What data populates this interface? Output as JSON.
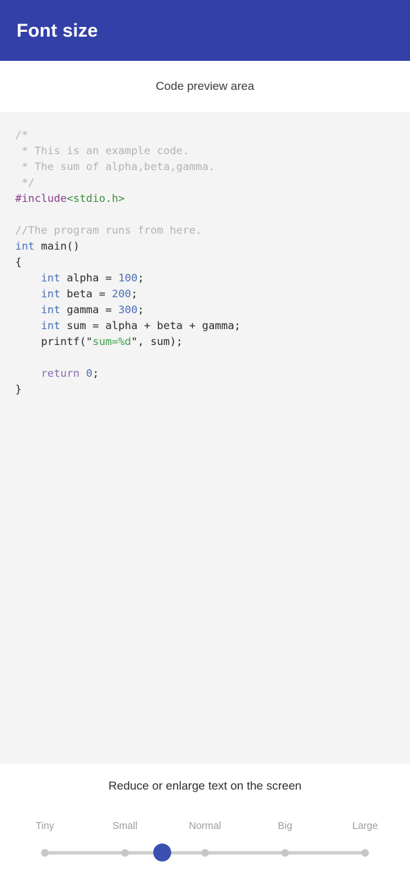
{
  "appbar": {
    "title": "Font size"
  },
  "preview": {
    "caption": "Code preview area",
    "code_lines": [
      {
        "segments": [
          {
            "t": "/*",
            "c": "cmt"
          }
        ]
      },
      {
        "segments": [
          {
            "t": " * This is an example code.",
            "c": "cmt"
          }
        ]
      },
      {
        "segments": [
          {
            "t": " * The sum of alpha,beta,gamma.",
            "c": "cmt"
          }
        ]
      },
      {
        "segments": [
          {
            "t": " */",
            "c": "cmt"
          }
        ]
      },
      {
        "segments": [
          {
            "t": "#include",
            "c": "pre"
          },
          {
            "t": "<stdio.h>",
            "c": "inc"
          }
        ]
      },
      {
        "segments": [
          {
            "t": "",
            "c": "pun"
          }
        ]
      },
      {
        "segments": [
          {
            "t": "//The program runs from here.",
            "c": "cmt"
          }
        ]
      },
      {
        "segments": [
          {
            "t": "int",
            "c": "kw"
          },
          {
            "t": " main()",
            "c": "pun"
          }
        ]
      },
      {
        "segments": [
          {
            "t": "{",
            "c": "pun"
          }
        ]
      },
      {
        "segments": [
          {
            "t": "    ",
            "c": "pun"
          },
          {
            "t": "int",
            "c": "kw"
          },
          {
            "t": " alpha = ",
            "c": "pun"
          },
          {
            "t": "100",
            "c": "num"
          },
          {
            "t": ";",
            "c": "pun"
          }
        ]
      },
      {
        "segments": [
          {
            "t": "    ",
            "c": "pun"
          },
          {
            "t": "int",
            "c": "kw"
          },
          {
            "t": " beta = ",
            "c": "pun"
          },
          {
            "t": "200",
            "c": "num"
          },
          {
            "t": ";",
            "c": "pun"
          }
        ]
      },
      {
        "segments": [
          {
            "t": "    ",
            "c": "pun"
          },
          {
            "t": "int",
            "c": "kw"
          },
          {
            "t": " gamma = ",
            "c": "pun"
          },
          {
            "t": "300",
            "c": "num"
          },
          {
            "t": ";",
            "c": "pun"
          }
        ]
      },
      {
        "segments": [
          {
            "t": "    ",
            "c": "pun"
          },
          {
            "t": "int",
            "c": "kw"
          },
          {
            "t": " sum = alpha + beta + gamma;",
            "c": "pun"
          }
        ]
      },
      {
        "segments": [
          {
            "t": "    printf(\"",
            "c": "pun"
          },
          {
            "t": "sum=%d",
            "c": "str"
          },
          {
            "t": "\", sum);",
            "c": "pun"
          }
        ]
      },
      {
        "segments": [
          {
            "t": "",
            "c": "pun"
          }
        ]
      },
      {
        "segments": [
          {
            "t": "    ",
            "c": "pun"
          },
          {
            "t": "return",
            "c": "kw2"
          },
          {
            "t": " ",
            "c": "pun"
          },
          {
            "t": "0",
            "c": "num"
          },
          {
            "t": ";",
            "c": "pun"
          }
        ]
      },
      {
        "segments": [
          {
            "t": "}",
            "c": "pun"
          }
        ]
      }
    ]
  },
  "slider": {
    "caption": "Reduce or enlarge text on the screen",
    "ticks": [
      {
        "label": "Tiny",
        "pos_pct": 0
      },
      {
        "label": "Small",
        "pos_pct": 25
      },
      {
        "label": "Normal",
        "pos_pct": 50
      },
      {
        "label": "Big",
        "pos_pct": 75
      },
      {
        "label": "Large",
        "pos_pct": 100
      }
    ],
    "thumb_pos_pct": 36.6,
    "selected_value": "Small"
  },
  "colors": {
    "appbar_bg": "#3340a8",
    "thumb": "#3a4fb0",
    "track": "#cfcfcf",
    "code_bg": "#f4f4f4"
  }
}
